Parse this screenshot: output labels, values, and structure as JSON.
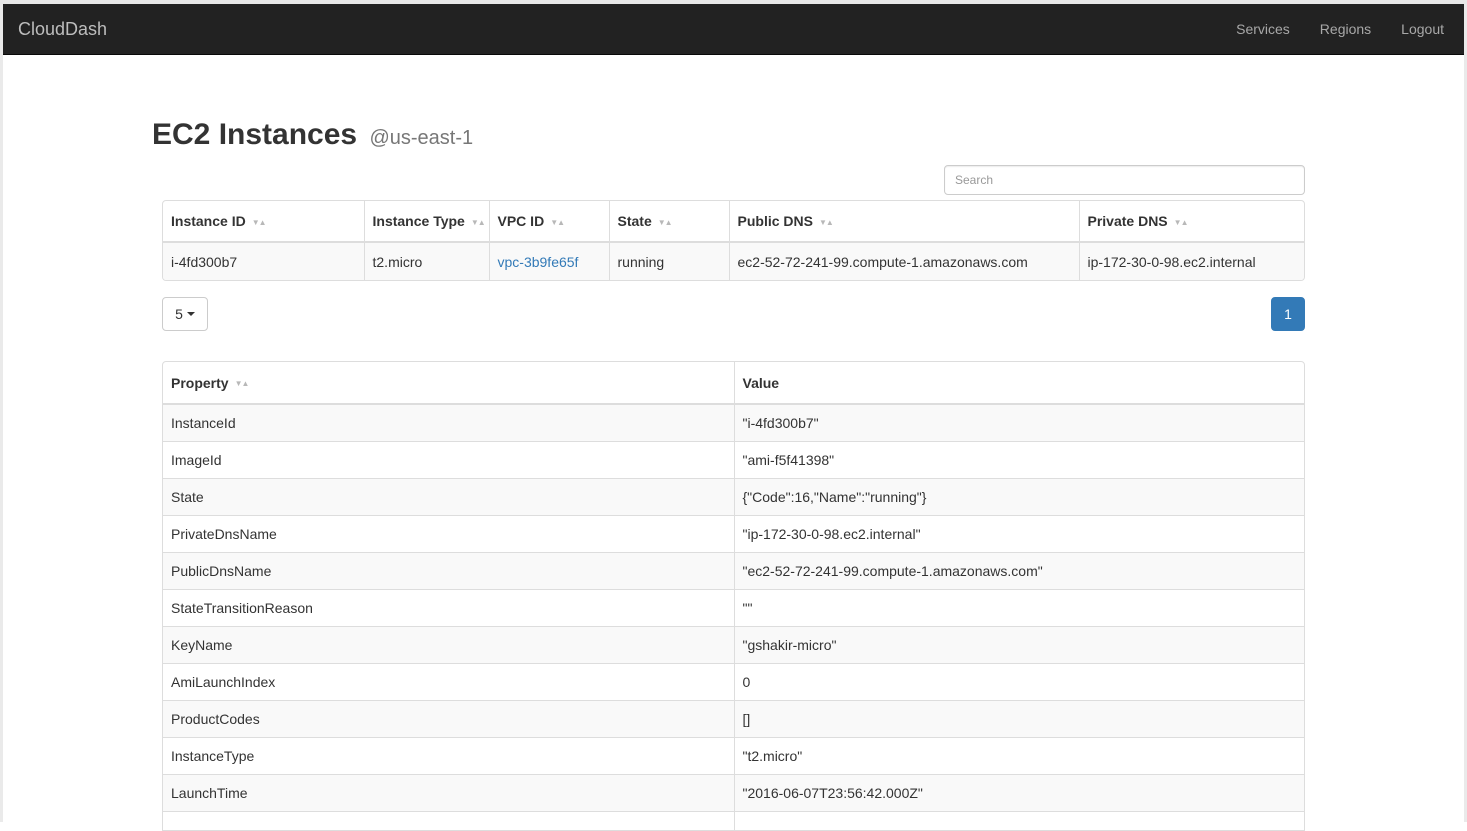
{
  "navbar": {
    "brand": "CloudDash",
    "links": [
      "Services",
      "Regions",
      "Logout"
    ]
  },
  "page": {
    "title": "EC2 Instances",
    "region": "@us-east-1"
  },
  "search": {
    "placeholder": "Search"
  },
  "instances_table": {
    "columns": [
      "Instance ID",
      "Instance Type",
      "VPC ID",
      "State",
      "Public DNS",
      "Private DNS"
    ],
    "rows": [
      [
        "i-4fd300b7",
        "t2.micro",
        "vpc-3b9fe65f",
        "running",
        "ec2-52-72-241-99.compute-1.amazonaws.com",
        "ip-172-30-0-98.ec2.internal"
      ]
    ]
  },
  "pagination": {
    "page_size": "5",
    "current_page": "1"
  },
  "properties_table": {
    "columns": [
      "Property",
      "Value"
    ],
    "rows": [
      [
        "InstanceId",
        "\"i-4fd300b7\""
      ],
      [
        "ImageId",
        "\"ami-f5f41398\""
      ],
      [
        "State",
        "{\"Code\":16,\"Name\":\"running\"}"
      ],
      [
        "PrivateDnsName",
        "\"ip-172-30-0-98.ec2.internal\""
      ],
      [
        "PublicDnsName",
        "\"ec2-52-72-241-99.compute-1.amazonaws.com\""
      ],
      [
        "StateTransitionReason",
        "\"\""
      ],
      [
        "KeyName",
        "\"gshakir-micro\""
      ],
      [
        "AmiLaunchIndex",
        "0"
      ],
      [
        "ProductCodes",
        "[]"
      ],
      [
        "InstanceType",
        "\"t2.micro\""
      ],
      [
        "LaunchTime",
        "\"2016-06-07T23:56:42.000Z\""
      ],
      [
        "",
        ""
      ]
    ]
  },
  "colors": {
    "navbar_bg": "#222222",
    "link": "#337ab7",
    "active_page": "#337ab7",
    "stripe": "#f9f9f9",
    "border": "#dddddd"
  }
}
